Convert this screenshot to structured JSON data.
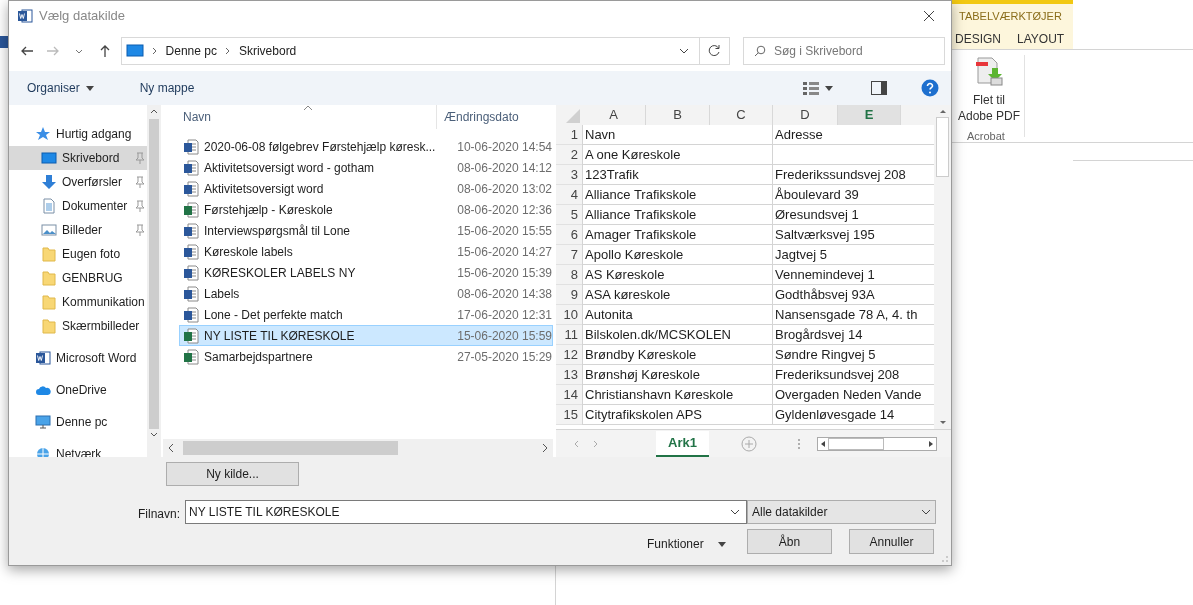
{
  "dialog": {
    "title": "Vælg datakilde",
    "address_path": [
      "Denne pc",
      "Skrivebord"
    ],
    "search": {
      "placeholder": "Søg i Skrivebord"
    },
    "toolbar": [
      {
        "label": "Organiser",
        "dropdown": true
      },
      {
        "label": "Ny mappe",
        "dropdown": false
      }
    ],
    "sidebar": {
      "items": [
        {
          "label": "Hurtig adgang",
          "kind": "star",
          "selected": false,
          "children": [
            {
              "label": "Skrivebord",
              "kind": "desktop",
              "pinned": true,
              "selected": true
            },
            {
              "label": "Overførsler",
              "kind": "download",
              "pinned": true,
              "selected": false
            },
            {
              "label": "Dokumenter",
              "kind": "document",
              "pinned": true,
              "selected": false
            },
            {
              "label": "Billeder",
              "kind": "pictures",
              "pinned": true,
              "selected": false
            },
            {
              "label": "Eugen foto",
              "kind": "folder",
              "pinned": false,
              "selected": false
            },
            {
              "label": "GENBRUG",
              "kind": "folder",
              "pinned": false,
              "selected": false
            },
            {
              "label": "Kommunikation",
              "kind": "folder",
              "pinned": false,
              "selected": false
            },
            {
              "label": "Skærmbilleder",
              "kind": "folder",
              "pinned": false,
              "selected": false
            }
          ]
        },
        {
          "label": "Microsoft Word",
          "kind": "word",
          "selected": false
        },
        {
          "label": "OneDrive",
          "kind": "cloud",
          "selected": false
        },
        {
          "label": "Denne pc",
          "kind": "pc",
          "selected": false
        },
        {
          "label": "Netværk",
          "kind": "network",
          "selected": false
        }
      ]
    },
    "files": {
      "columns": [
        "Navn",
        "Ændringsdato"
      ],
      "rows": [
        {
          "name": "2020-06-08 følgebrev Førstehjælp køresk...",
          "date": "10-06-2020 14:54",
          "kind": "word",
          "selected": false
        },
        {
          "name": "Aktivitetsoversigt word - gotham",
          "date": "08-06-2020 14:12",
          "kind": "word",
          "selected": false
        },
        {
          "name": "Aktivitetsoversigt word",
          "date": "08-06-2020 13:02",
          "kind": "word",
          "selected": false
        },
        {
          "name": "Førstehjælp - Køreskole",
          "date": "08-06-2020 12:36",
          "kind": "excel",
          "selected": false
        },
        {
          "name": "Interviewspørgsmål til Lone",
          "date": "15-06-2020 15:55",
          "kind": "word",
          "selected": false
        },
        {
          "name": "Køreskole labels",
          "date": "15-06-2020 14:27",
          "kind": "word",
          "selected": false
        },
        {
          "name": "KØRESKOLER LABELS NY",
          "date": "15-06-2020 15:39",
          "kind": "word",
          "selected": false
        },
        {
          "name": "Labels",
          "date": "08-06-2020 14:38",
          "kind": "word",
          "selected": false
        },
        {
          "name": "Lone - Det perfekte match",
          "date": "17-06-2020 12:31",
          "kind": "word",
          "selected": false
        },
        {
          "name": "NY LISTE TIL KØRESKOLE",
          "date": "15-06-2020 15:59",
          "kind": "excel",
          "selected": true
        },
        {
          "name": "Samarbejdspartnere",
          "date": "27-05-2020 15:29",
          "kind": "excel",
          "selected": false
        }
      ]
    },
    "preview": {
      "columns": [
        {
          "label": "A",
          "selected": false
        },
        {
          "label": "B",
          "selected": false
        },
        {
          "label": "C",
          "selected": false
        },
        {
          "label": "D",
          "selected": false
        },
        {
          "label": "E",
          "selected": true
        }
      ],
      "rows": [
        {
          "number": "1",
          "name": "Navn",
          "address": "Adresse"
        },
        {
          "number": "2",
          "name": "A one Køreskole"
        },
        {
          "number": "3",
          "name": "123Trafik",
          "address": "Frederikssundsvej 208"
        },
        {
          "number": "4",
          "name": "Alliance Trafikskole",
          "address": "Åboulevard 39"
        },
        {
          "number": "5",
          "name": "Alliance Trafikskole",
          "address": "Øresundsvej 1"
        },
        {
          "number": "6",
          "name": "Amager Trafikskole",
          "address": "Saltværksvej 195"
        },
        {
          "number": "7",
          "name": "Apollo Køreskole",
          "address": "Jagtvej 5"
        },
        {
          "number": "8",
          "name": "AS Køreskole",
          "address": "Vennemindevej 1"
        },
        {
          "number": "9",
          "name": "ASA køreskole",
          "address": "Godthåbsvej 93A"
        },
        {
          "number": "10",
          "name": "Autonita",
          "address": "Nansensgade 78 A, 4. th"
        },
        {
          "number": "11",
          "name": "Bilskolen.dk/MCSKOLEN",
          "address": "Brogårdsvej 14"
        },
        {
          "number": "12",
          "name": "Brøndby Køreskole",
          "address": "Søndre Ringvej 5"
        },
        {
          "number": "13",
          "name": "Brønshøj Køreskole",
          "address": "Frederiksundsvej 208"
        },
        {
          "number": "14",
          "name": "Christianshavn Køreskole",
          "address": "Overgaden Neden Vande"
        },
        {
          "number": "15",
          "name": "Citytrafikskolen APS",
          "address": "Gyldenløvesgade 14"
        }
      ],
      "sheet_tabs": [
        {
          "label": "Ark1",
          "selected": true
        }
      ]
    },
    "new_source_button": "Ny kilde...",
    "filename": {
      "label": "Filnavn:",
      "value": "NY LISTE TIL KØRESKOLE"
    },
    "file_type": "Alle datakilder",
    "tools_menu": "Funktioner",
    "buttons": [
      {
        "label": "Åbn",
        "kind": "open"
      },
      {
        "label": "Annuller",
        "kind": "cancel"
      }
    ]
  },
  "ribbon": {
    "contextual_label": "TABELVÆRKTØJER",
    "tabs": [
      "DESIGN",
      "LAYOUT"
    ],
    "command": "Flet til Adobe PDF",
    "group": "Acrobat"
  }
}
